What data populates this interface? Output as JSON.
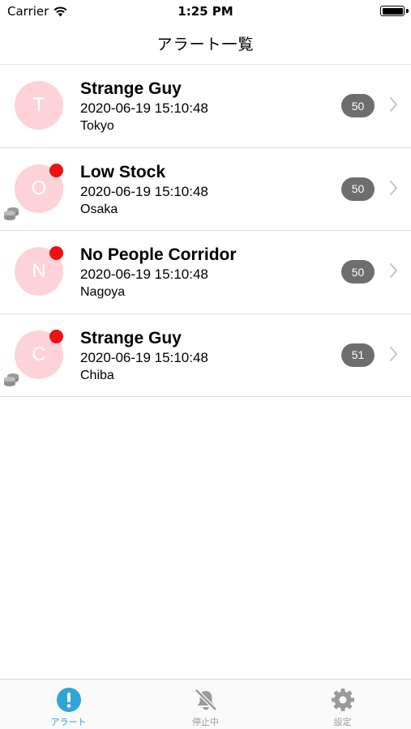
{
  "status_bar": {
    "carrier": "Carrier",
    "time": "1:25 PM"
  },
  "nav": {
    "title": "アラート一覧"
  },
  "alerts": [
    {
      "initial": "T",
      "title": "Strange Guy",
      "time": "2020-06-19 15:10:48",
      "place": "Tokyo",
      "count": "50",
      "unread": false,
      "coins": false
    },
    {
      "initial": "O",
      "title": "Low Stock",
      "time": "2020-06-19 15:10:48",
      "place": "Osaka",
      "count": "50",
      "unread": true,
      "coins": true
    },
    {
      "initial": "N",
      "title": "No People Corridor",
      "time": "2020-06-19 15:10:48",
      "place": "Nagoya",
      "count": "50",
      "unread": true,
      "coins": false
    },
    {
      "initial": "C",
      "title": "Strange Guy",
      "time": "2020-06-19 15:10:48",
      "place": "Chiba",
      "count": "51",
      "unread": true,
      "coins": true
    }
  ],
  "tabs": [
    {
      "label": "アラート",
      "icon": "alert-icon",
      "active": true
    },
    {
      "label": "停止中",
      "icon": "muted-bell-icon",
      "active": false
    },
    {
      "label": "設定",
      "icon": "gear-icon",
      "active": false
    }
  ],
  "colors": {
    "avatar_bg": "#fdd3d9",
    "unread_dot": "#f01010",
    "badge_bg": "#6e6e6e",
    "active_tab": "#2fa4d8",
    "inactive_tab": "#9a9a9a"
  }
}
